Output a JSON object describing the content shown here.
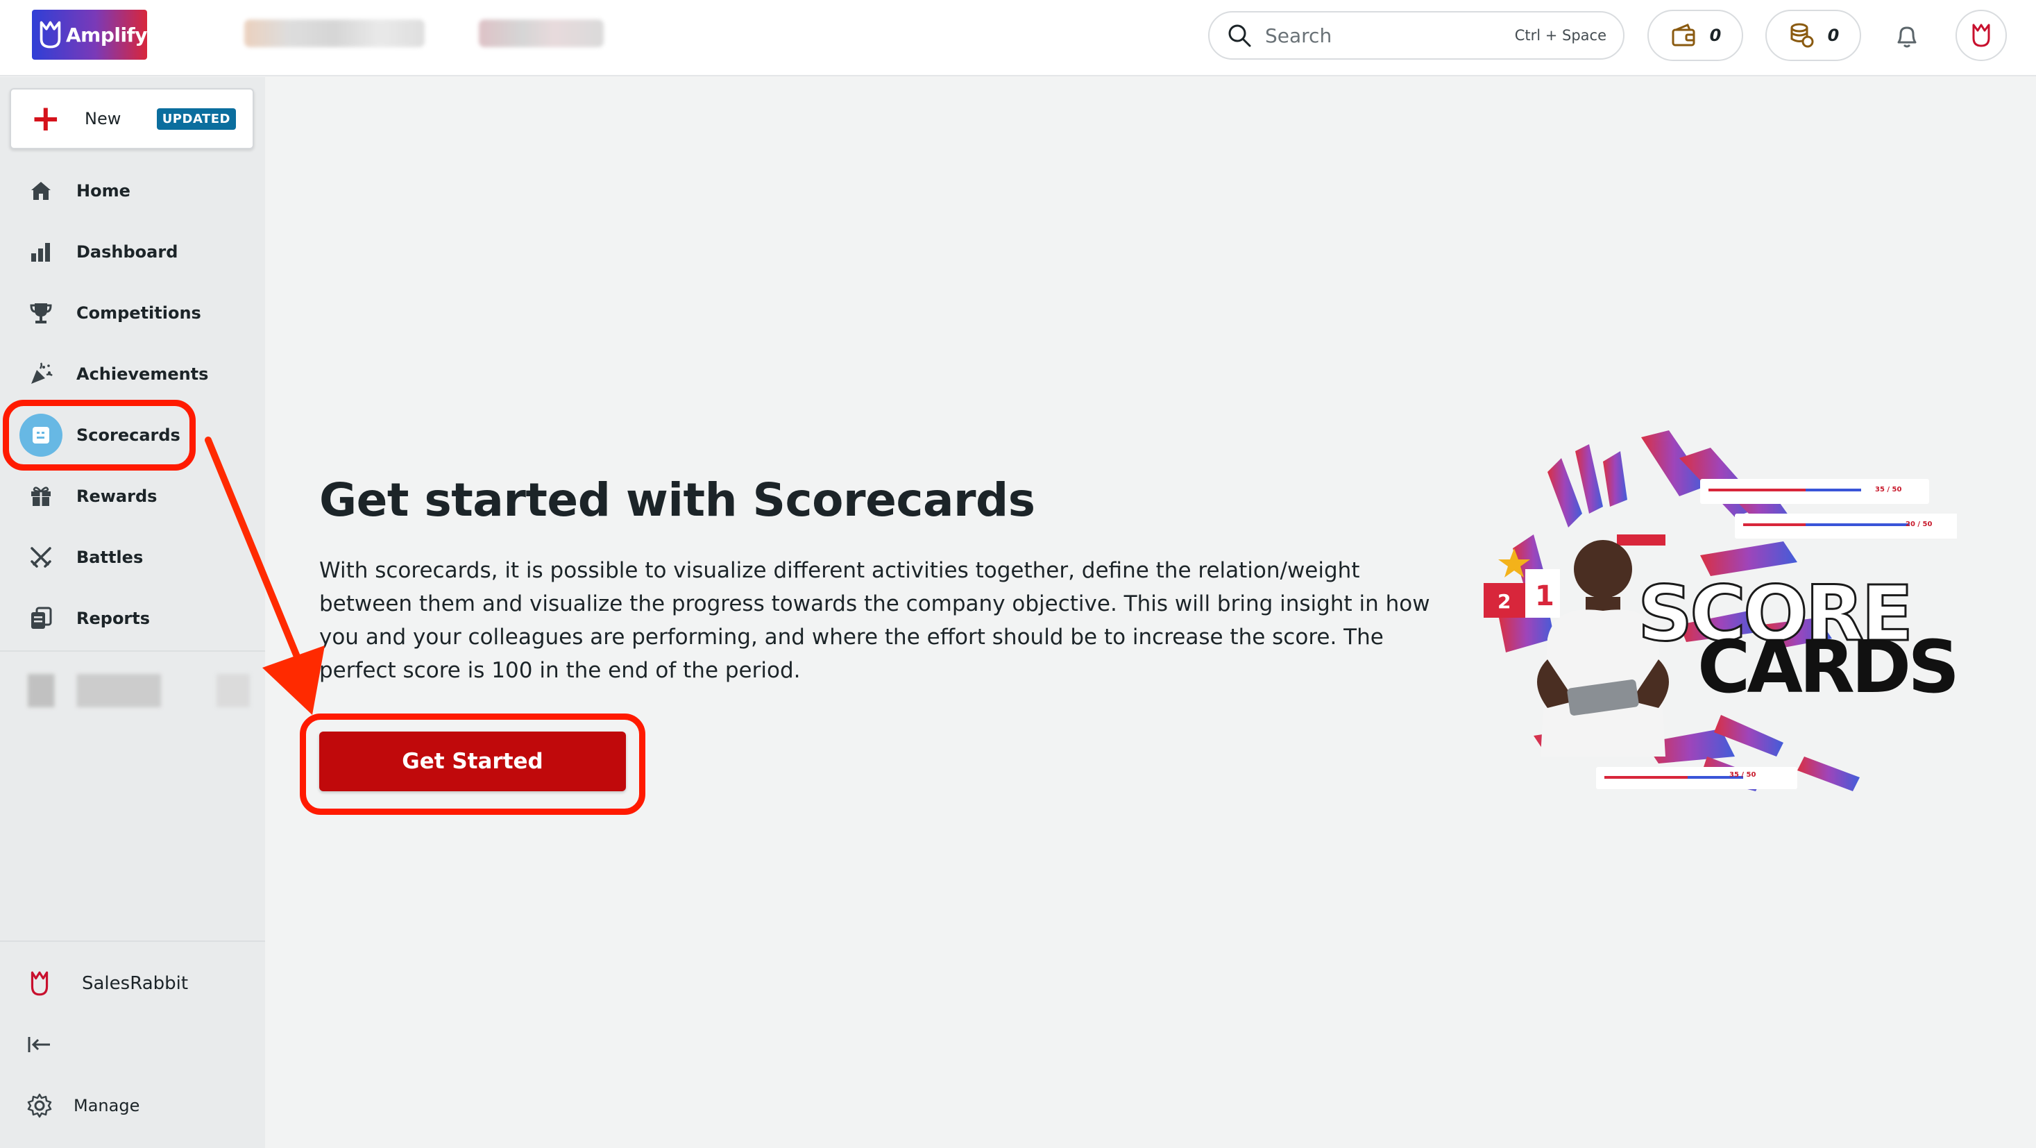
{
  "brand": {
    "name": "Amplify"
  },
  "search": {
    "placeholder": "Search",
    "shortcut": "Ctrl + Space"
  },
  "header": {
    "wallet_count": "0",
    "coins_count": "0"
  },
  "sidebar": {
    "new_label": "New",
    "new_badge": "UPDATED",
    "items": [
      {
        "label": "Home",
        "icon": "home-icon"
      },
      {
        "label": "Dashboard",
        "icon": "bar-chart-icon"
      },
      {
        "label": "Competitions",
        "icon": "trophy-icon"
      },
      {
        "label": "Achievements",
        "icon": "party-popper-icon"
      },
      {
        "label": "Scorecards",
        "icon": "scorecard-icon",
        "active": true
      },
      {
        "label": "Rewards",
        "icon": "gift-icon"
      },
      {
        "label": "Battles",
        "icon": "crossed-swords-icon"
      },
      {
        "label": "Reports",
        "icon": "reports-icon"
      }
    ],
    "org_name": "SalesRabbit",
    "manage_label": "Manage"
  },
  "main": {
    "title": "Get started with Scorecards",
    "description": "With scorecards, it is possible to visualize different activities together, define the relation/weight between them and visualize the progress towards the company objective. This will bring insight in how you and your colleagues are performing, and where the effort should be to increase the score. The perfect score is 100 in the end of the period.",
    "cta_label": "Get Started",
    "illustration": {
      "word1": "SCORE",
      "word2": "CARDS",
      "mini1": "35 / 50",
      "mini2": "20 / 50",
      "mini3": "35 / 50",
      "podium": [
        "2",
        "1"
      ]
    }
  },
  "colors": {
    "accent": "#c0090b",
    "badge": "#0b6e9e",
    "active_icon_bg": "#67b8e4",
    "annotation": "#ff1a00"
  }
}
